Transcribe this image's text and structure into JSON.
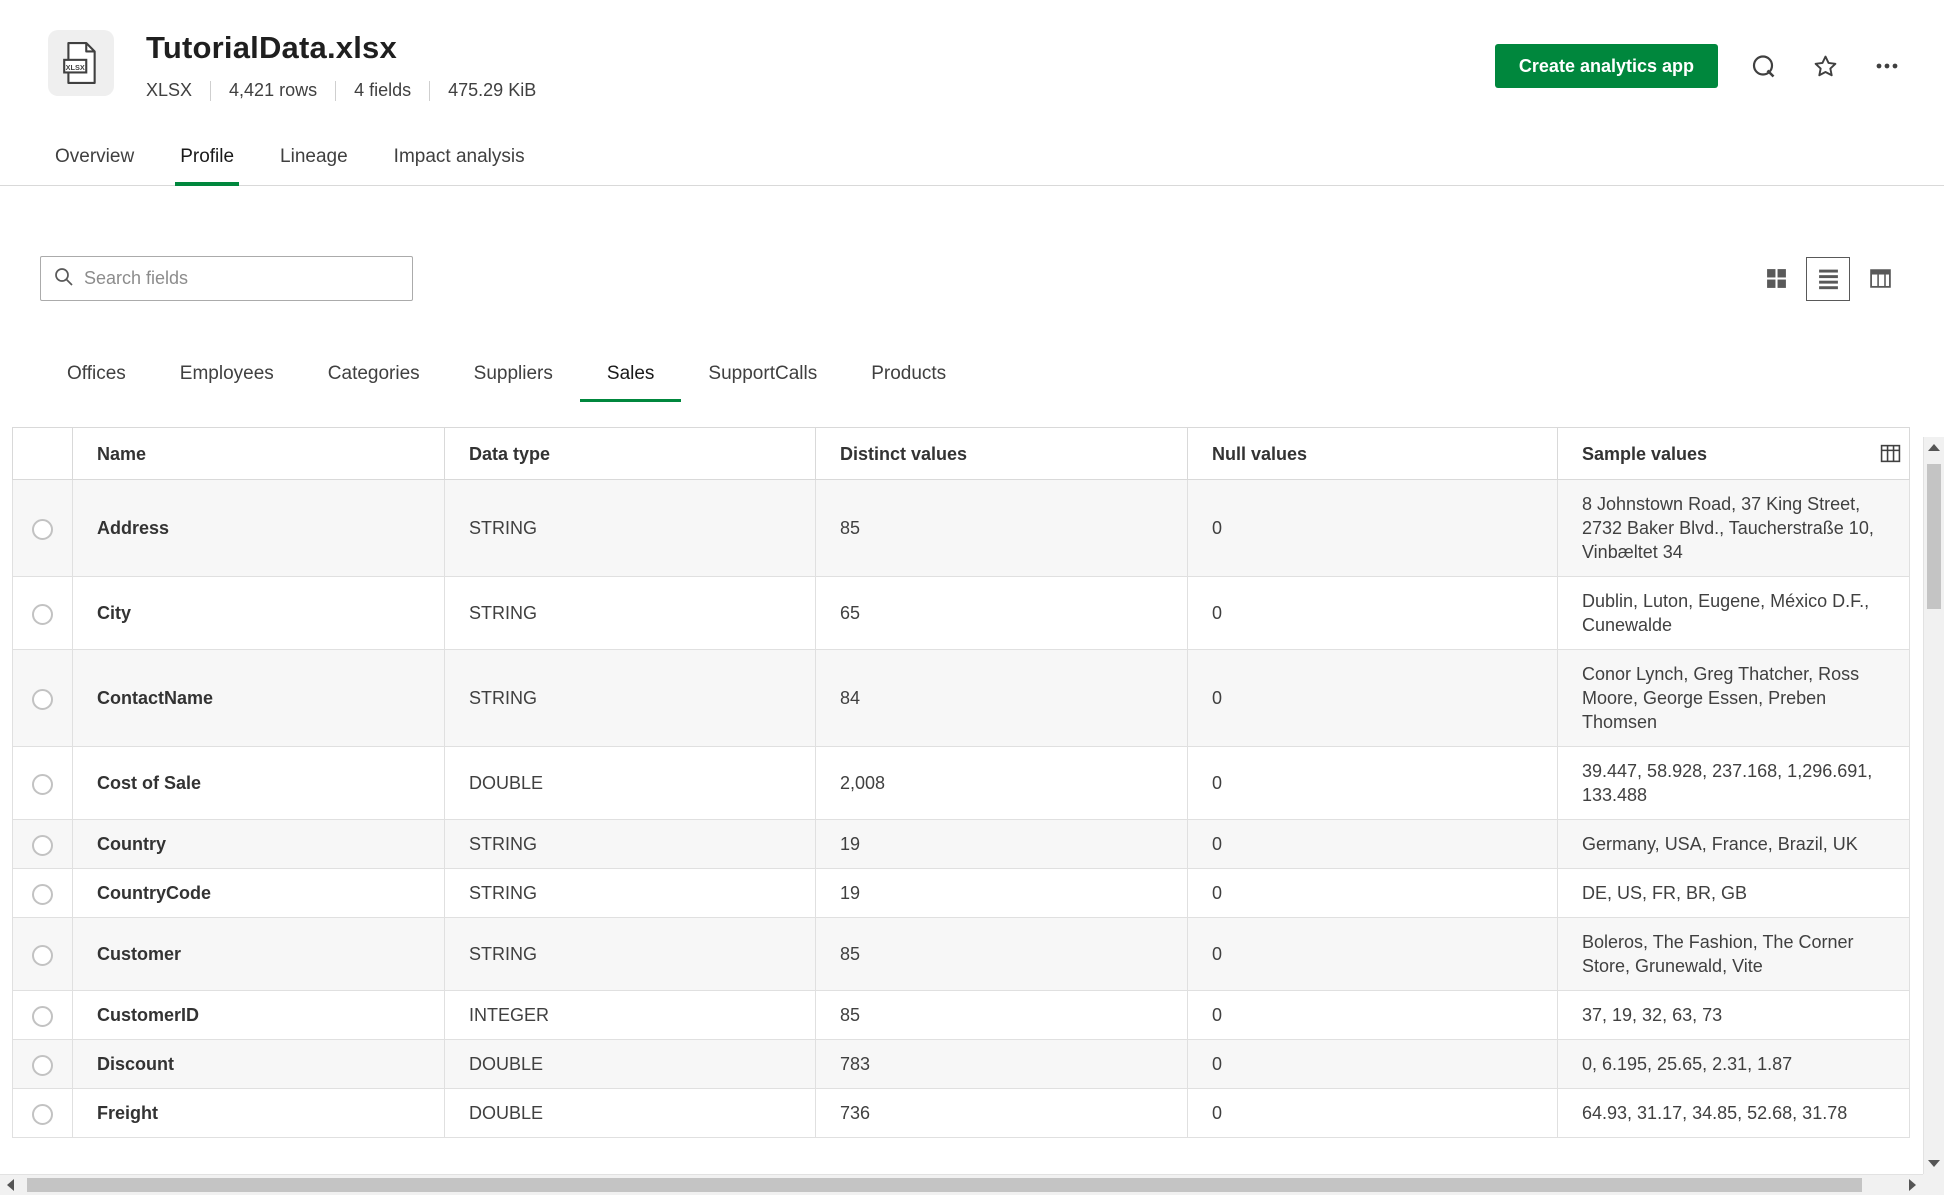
{
  "colors": {
    "accent_green": "#00873d",
    "text_dark": "#404040",
    "border": "#d9d9d9"
  },
  "file_header": {
    "title": "TutorialData.xlsx",
    "file_icon_label": "XLSX",
    "file_type": "XLSX",
    "row_count": "4,421 rows",
    "field_count": "4 fields",
    "file_size": "475.29 KiB",
    "create_app_button": "Create analytics app"
  },
  "icons": [
    "xlsx-file-icon",
    "q-loop-icon",
    "star-icon",
    "ellipsis-icon",
    "search-icon",
    "grid-view-icon",
    "list-view-icon",
    "table-view-icon",
    "column-picker-icon"
  ],
  "main_tabs": {
    "active": "Profile",
    "items": [
      {
        "label": "Overview"
      },
      {
        "label": "Profile"
      },
      {
        "label": "Lineage"
      },
      {
        "label": "Impact analysis"
      }
    ]
  },
  "toolbar": {
    "search_placeholder": "Search fields",
    "view_modes": [
      "grid-view",
      "list-view",
      "table-view"
    ],
    "active_view": "list-view"
  },
  "sheet_tabs": {
    "active": "Sales",
    "items": [
      {
        "label": "Offices"
      },
      {
        "label": "Employees"
      },
      {
        "label": "Categories"
      },
      {
        "label": "Suppliers"
      },
      {
        "label": "Sales"
      },
      {
        "label": "SupportCalls"
      },
      {
        "label": "Products"
      }
    ]
  },
  "table": {
    "headers": [
      "Name",
      "Data type",
      "Distinct values",
      "Null values",
      "Sample values"
    ],
    "rows": [
      {
        "name": "Address",
        "data_type": "STRING",
        "distinct_values": "85",
        "null_values": "0",
        "sample_values": "8 Johnstown Road, 37 King Street, 2732 Baker Blvd., Taucherstraße 10, Vinbæltet 34"
      },
      {
        "name": "City",
        "data_type": "STRING",
        "distinct_values": "65",
        "null_values": "0",
        "sample_values": "Dublin, Luton, Eugene, México D.F., Cunewalde"
      },
      {
        "name": "ContactName",
        "data_type": "STRING",
        "distinct_values": "84",
        "null_values": "0",
        "sample_values": "Conor Lynch, Greg Thatcher, Ross Moore, George Essen, Preben Thomsen"
      },
      {
        "name": "Cost of Sale",
        "data_type": "DOUBLE",
        "distinct_values": "2,008",
        "null_values": "0",
        "sample_values": "39.447, 58.928, 237.168, 1,296.691, 133.488"
      },
      {
        "name": "Country",
        "data_type": "STRING",
        "distinct_values": "19",
        "null_values": "0",
        "sample_values": "Germany, USA, France, Brazil, UK"
      },
      {
        "name": "CountryCode",
        "data_type": "STRING",
        "distinct_values": "19",
        "null_values": "0",
        "sample_values": "DE, US, FR, BR, GB"
      },
      {
        "name": "Customer",
        "data_type": "STRING",
        "distinct_values": "85",
        "null_values": "0",
        "sample_values": "Boleros, The Fashion, The Corner Store, Grunewald, Vite"
      },
      {
        "name": "CustomerID",
        "data_type": "INTEGER",
        "distinct_values": "85",
        "null_values": "0",
        "sample_values": "37, 19, 32, 63, 73"
      },
      {
        "name": "Discount",
        "data_type": "DOUBLE",
        "distinct_values": "783",
        "null_values": "0",
        "sample_values": "0, 6.195, 25.65, 2.31, 1.87"
      },
      {
        "name": "Freight",
        "data_type": "DOUBLE",
        "distinct_values": "736",
        "null_values": "0",
        "sample_values": "64.93, 31.17, 34.85, 52.68, 31.78"
      }
    ]
  }
}
